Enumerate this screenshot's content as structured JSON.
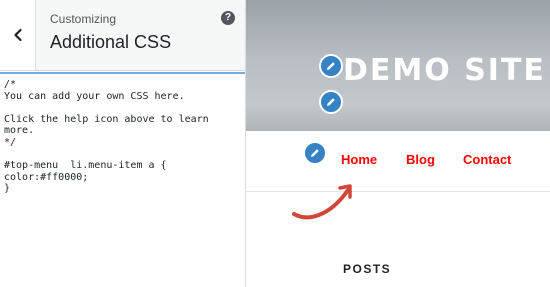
{
  "customizer": {
    "breadcrumb": "Customizing",
    "section_title": "Additional CSS",
    "help_symbol": "?",
    "code_lines": [
      "/*",
      "You can add your own CSS here.",
      "",
      "Click the help icon above to learn",
      "more.",
      "*/",
      "",
      "#top-menu  li.menu-item a {",
      "color:#ff0000;",
      "}"
    ]
  },
  "preview": {
    "site_title": "DEMO SITE",
    "menu": [
      {
        "label": "Home"
      },
      {
        "label": "Blog"
      },
      {
        "label": "Contact"
      }
    ],
    "posts_heading": "POSTS"
  },
  "colors": {
    "menu_link": "#ff0000",
    "edit_shortcut": "#3582c4",
    "arrow": "#d0473a"
  },
  "icons": {
    "back": "chevron-left-icon",
    "help": "help-icon",
    "edit": "pencil-icon"
  }
}
